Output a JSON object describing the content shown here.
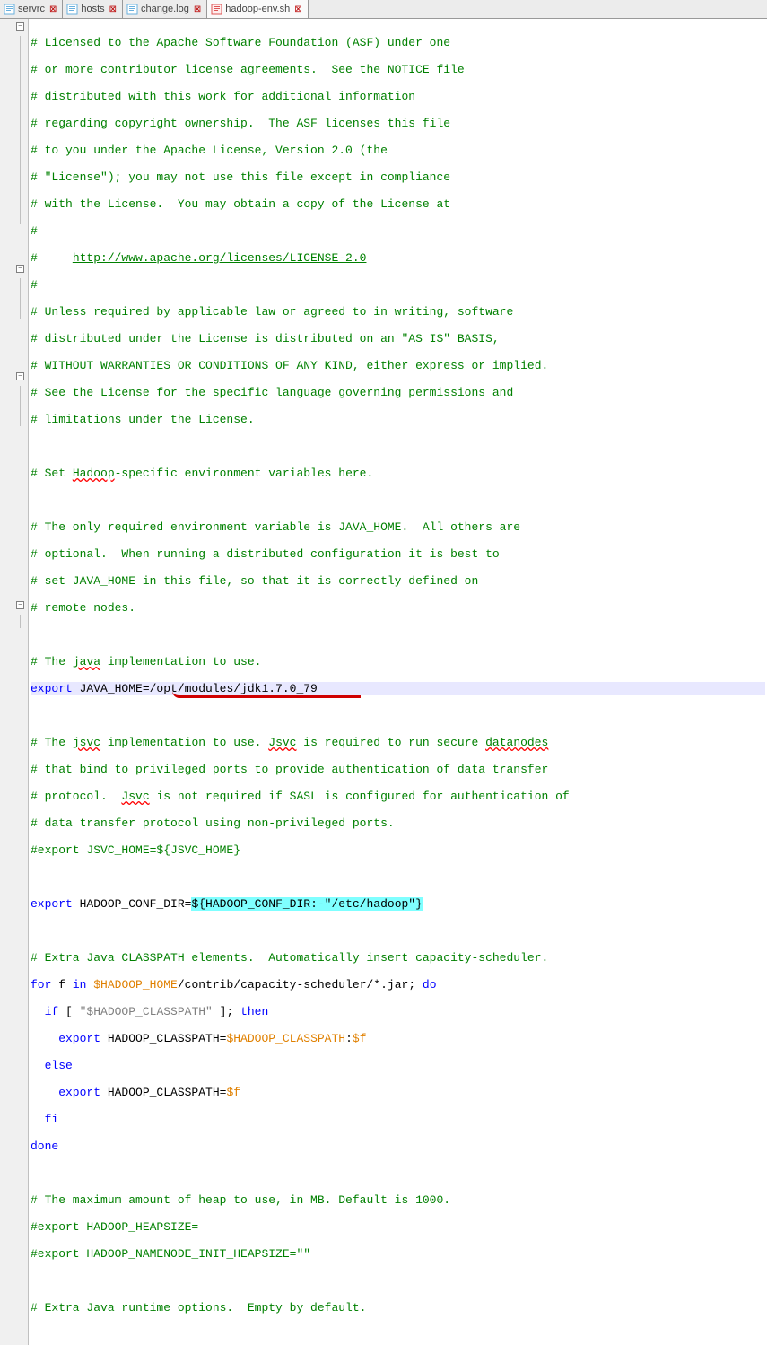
{
  "tabs": [
    {
      "label": "servrc",
      "active": false
    },
    {
      "label": "hosts",
      "active": false
    },
    {
      "label": "change.log",
      "active": false
    },
    {
      "label": "hadoop-env.sh",
      "active": true
    }
  ],
  "lines": {
    "l1": "# Licensed to the Apache Software Foundation (ASF) under one",
    "l2": "# or more contributor license agreements.  See the NOTICE file",
    "l3": "# distributed with this work for additional information",
    "l4": "# regarding copyright ownership.  The ASF licenses this file",
    "l5": "# to you under the Apache License, Version 2.0 (the",
    "l6": "# \"License\"); you may not use this file except in compliance",
    "l7": "# with the License.  You may obtain a copy of the License at",
    "l8": "#",
    "l9a": "#     ",
    "l9b": "http://www.apache.org/licenses/LICENSE-2.0",
    "l10": "#",
    "l11": "# Unless required by applicable law or agreed to in writing, software",
    "l12": "# distributed under the License is distributed on an \"AS IS\" BASIS,",
    "l13": "# WITHOUT WARRANTIES OR CONDITIONS OF ANY KIND, either express or implied.",
    "l14": "# See the License for the specific language governing permissions and",
    "l15": "# limitations under the License.",
    "l17a": "# Set ",
    "l17b": "Hadoop",
    "l17c": "-specific environment variables here.",
    "l19": "# The only required environment variable is JAVA_HOME.  All others are",
    "l20": "# optional.  When running a distributed configuration it is best to",
    "l21": "# set JAVA_HOME in this file, so that it is correctly defined on",
    "l22": "# remote nodes.",
    "l24a": "# The ",
    "l24b": "java",
    "l24c": " implementation to use.",
    "l25a": "export",
    "l25b": " JAVA_HOME",
    "l25c": "=/opt/modules/jdk1.7.0_79",
    "l27a": "# The ",
    "l27b": "jsvc",
    "l27c": " implementation to use. ",
    "l27d": "Jsvc",
    "l27e": " is required to run secure ",
    "l27f": "datanodes",
    "l28": "# that bind to privileged ports to provide authentication of data transfer",
    "l29a": "# protocol.  ",
    "l29b": "Jsvc",
    "l29c": " is not required if SASL is configured for authentication of",
    "l30": "# data transfer protocol using non-privileged ports.",
    "l31": "#export JSVC_HOME=${JSVC_HOME}",
    "l33a": "export",
    "l33b": " HADOOP_CONF_DIR",
    "l33c": "=",
    "l33d": "${HADOOP_CONF_DIR:-\"/etc/hadoop\"}",
    "l35": "# Extra Java CLASSPATH elements.  Automatically insert capacity-scheduler.",
    "l36a": "for",
    "l36b": " f ",
    "l36c": "in",
    "l36d": " ",
    "l36e": "$HADOOP_HOME",
    "l36f": "/contrib/capacity-scheduler/*.jar",
    "l36g": ";",
    "l36h": " do",
    "l37a": "  if",
    "l37b": " [ ",
    "l37c": "\"$HADOOP_CLASSPATH\"",
    "l37d": " ]",
    "l37e": ";",
    "l37f": " then",
    "l38a": "    export",
    "l38b": " HADOOP_CLASSPATH",
    "l38c": "=",
    "l38d": "$HADOOP_CLASSPATH",
    "l38e": ":",
    "l38f": "$f",
    "l39": "  else",
    "l40a": "    export",
    "l40b": " HADOOP_CLASSPATH",
    "l40c": "=",
    "l40d": "$f",
    "l41": "  fi",
    "l42": "done",
    "l44": "# The maximum amount of heap to use, in MB. Default is 1000.",
    "l45": "#export HADOOP_HEAPSIZE=",
    "l46": "#export HADOOP_NAMENODE_INIT_HEAPSIZE=\"\"",
    "l48": "# Extra Java runtime options.  Empty by default."
  }
}
